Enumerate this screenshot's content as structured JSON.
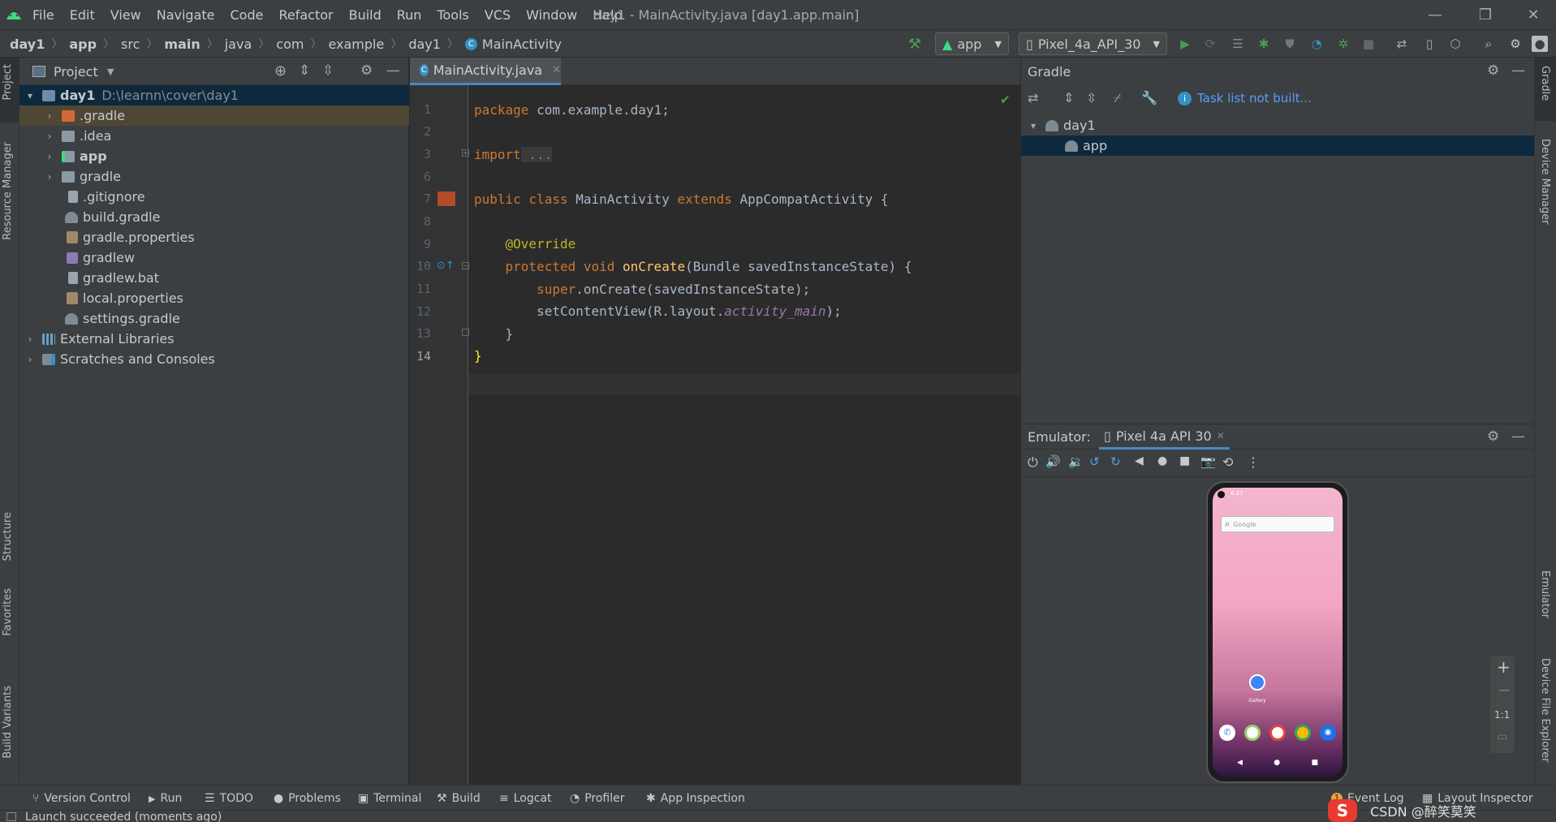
{
  "menubar": {
    "items": [
      "File",
      "Edit",
      "View",
      "Navigate",
      "Code",
      "Refactor",
      "Build",
      "Run",
      "Tools",
      "VCS",
      "Window",
      "Help"
    ],
    "title": "day1 - MainActivity.java [day1.app.main]"
  },
  "navbar": {
    "crumbs": [
      "day1",
      "app",
      "src",
      "main",
      "java",
      "com",
      "example",
      "day1",
      "MainActivity"
    ],
    "config": "app",
    "device": "Pixel_4a_API_30"
  },
  "left_strip": [
    "Project",
    "Resource Manager",
    "Structure",
    "Favorites",
    "Build Variants"
  ],
  "right_strip": [
    "Gradle",
    "Device Manager",
    "Emulator",
    "Device File Explorer"
  ],
  "project": {
    "title": "Project",
    "root_name": "day1",
    "root_path": "D:\\learnn\\cover\\day1",
    "items": [
      ".gradle",
      ".idea",
      "app",
      "gradle",
      ".gitignore",
      "build.gradle",
      "gradle.properties",
      "gradlew",
      "gradlew.bat",
      "local.properties",
      "settings.gradle"
    ],
    "external": "External Libraries",
    "scratches": "Scratches and Consoles"
  },
  "editor": {
    "tab": "MainActivity.java",
    "lines": [
      "1",
      "2",
      "3",
      "6",
      "7",
      "8",
      "9",
      "10",
      "11",
      "12",
      "13",
      "14"
    ],
    "code": {
      "l1_kw": "package",
      "l1_rest": " com.example.day1;",
      "l3_kw": "import",
      "l3_rest": " ...",
      "l7_kw": "public class",
      "l7_name": " MainActivity ",
      "l7_kw2": "extends",
      "l7_rest": " AppCompatActivity {",
      "l9_ann": "@Override",
      "l10_kw": "protected void",
      "l10_fn": " onCreate",
      "l10_rest": "(Bundle savedInstanceState) {",
      "l11_kw": "super",
      "l11_rest": ".onCreate(savedInstanceState);",
      "l12_pre": "setContentView(R.layout.",
      "l12_it": "activity_main",
      "l12_post": ");",
      "l13": "}",
      "l14": "}"
    }
  },
  "gradle": {
    "title": "Gradle",
    "task_msg": "Task list not built...",
    "root": "day1",
    "child": "app"
  },
  "emulator": {
    "label": "Emulator:",
    "tab": "Pixel 4a API 30",
    "zoom_label": "1:1",
    "search_text": "Google",
    "app_label": "Gallery"
  },
  "bottom_tabs": [
    "Version Control",
    "Run",
    "TODO",
    "Problems",
    "Terminal",
    "Build",
    "Logcat",
    "Profiler",
    "App Inspection"
  ],
  "bottom_right": [
    "Event Log",
    "Layout Inspector"
  ],
  "watermark": "CSDN @醉笑莫笑",
  "status": "Launch succeeded (moments ago)",
  "colors": {
    "accent": "#4a88c7",
    "keyword": "#cc7832",
    "annotation": "#bbb529",
    "function": "#ffc66d",
    "green_run": "#499c54"
  }
}
